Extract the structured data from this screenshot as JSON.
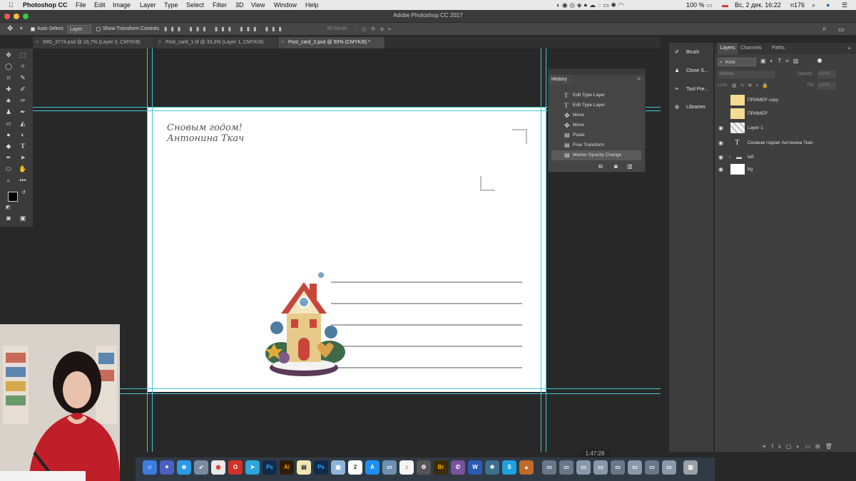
{
  "menubar": {
    "apple": "",
    "app": "Photoshop CC",
    "items": [
      "File",
      "Edit",
      "Image",
      "Layer",
      "Type",
      "Select",
      "Filter",
      "3D",
      "View",
      "Window",
      "Help"
    ],
    "battery": "100 %",
    "datetime": "Вс, 2 дек. 16:22",
    "user": "n176"
  },
  "titlebar": {
    "title": "Adobe Photoshop CC 2017"
  },
  "options": {
    "auto_select_label": "Auto-Select:",
    "auto_select_value": "Layer",
    "transform_label": "Show Transform Controls",
    "mode_3d": "3D Mode:"
  },
  "tabs": [
    {
      "label": "IMG_3774.psd @ 16,7% (Layer 3, CMYK/8)"
    },
    {
      "label": "Post_card_1.tif @ 33,3% (Layer 1, CMYK/8)"
    },
    {
      "label": "Post_card_2.psd @ 50% (CMYK/8) *"
    }
  ],
  "canvas": {
    "greeting_line1": "Сновым годом!",
    "greeting_line2": "Антонина Ткач"
  },
  "history": {
    "title": "History",
    "items": [
      {
        "label": "Edit Type Layer",
        "icon": "type-icon"
      },
      {
        "label": "Edit Type Layer",
        "icon": "type-icon"
      },
      {
        "label": "Move",
        "icon": "move-icon"
      },
      {
        "label": "Move",
        "icon": "move-icon"
      },
      {
        "label": "Paste",
        "icon": "document-icon"
      },
      {
        "label": "Free Transform",
        "icon": "document-icon"
      },
      {
        "label": "Master Opacity Change",
        "icon": "document-icon"
      }
    ]
  },
  "strip": {
    "items": [
      {
        "label": "Brush",
        "icon": "brush-icon"
      },
      {
        "label": "Clone S...",
        "icon": "clone-stamp-icon"
      },
      {
        "label": "Tool Pre...",
        "icon": "tool-preset-icon"
      },
      {
        "label": "Libraries",
        "icon": "libraries-icon"
      }
    ]
  },
  "layers": {
    "tabs": [
      "Layers",
      "Channels",
      "Paths"
    ],
    "filter": "Kind",
    "blend": "Normal",
    "opacity_label": "Opacity:",
    "opacity_value": "100%",
    "lock_label": "Lock:",
    "fill_label": "Fill:",
    "fill_value": "100%",
    "rows": [
      {
        "name": "ПРИМЕР copy",
        "visible": false
      },
      {
        "name": "ПРИМЕР",
        "visible": false
      },
      {
        "name": "Layer 1",
        "visible": true
      },
      {
        "name": "Сновым годом! Антонина Ткач",
        "visible": true
      },
      {
        "name": "left",
        "visible": true
      },
      {
        "name": "bg",
        "visible": true
      }
    ]
  },
  "status": {
    "timecode": "1:47:28"
  },
  "colors": {
    "guide": "#3ec8d9",
    "accent": "#1b6ac9"
  }
}
